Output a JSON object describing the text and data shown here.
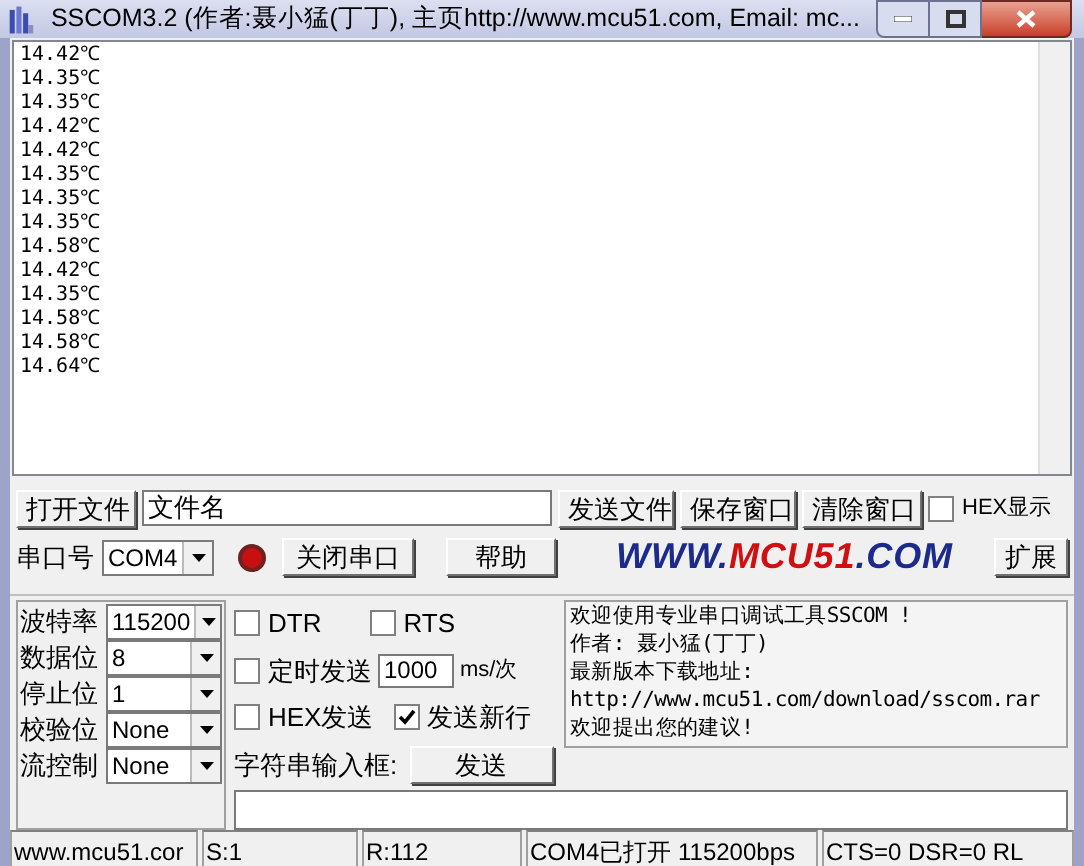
{
  "window": {
    "title": "SSCOM3.2 (作者:聂小猛(丁丁), 主页http://www.mcu51.com,  Email: mc..."
  },
  "receive_lines": [
    "14.42℃",
    "14.35℃",
    "14.35℃",
    "14.42℃",
    "14.42℃",
    "14.35℃",
    "14.35℃",
    "14.35℃",
    "14.58℃",
    "14.42℃",
    "14.35℃",
    "14.58℃",
    "14.58℃",
    "14.64℃"
  ],
  "file_row": {
    "open_file_button": "打开文件",
    "file_name_field": "文件名",
    "send_file_button": "发送文件",
    "save_window_button": "保存窗口",
    "clear_window_button": "清除窗口",
    "hex_display": {
      "label": "HEX显示",
      "checked": false
    }
  },
  "port_row": {
    "port_label": "串口号",
    "port_value": "COM4",
    "port_open": true,
    "close_port_button": "关闭串口",
    "help_button": "帮助",
    "logo_parts": [
      {
        "text": "WWW.",
        "color": "#1c2a8c"
      },
      {
        "text": "MCU51",
        "color": "#d01010"
      },
      {
        "text": ".COM",
        "color": "#1c2a8c"
      }
    ],
    "expand_button": "扩展"
  },
  "settings": [
    {
      "label": "波特率",
      "value": "115200"
    },
    {
      "label": "数据位",
      "value": "8"
    },
    {
      "label": "停止位",
      "value": "1"
    },
    {
      "label": "校验位",
      "value": "None"
    },
    {
      "label": "流控制",
      "value": "None"
    }
  ],
  "options": {
    "dtr": {
      "label": "DTR",
      "checked": false
    },
    "rts": {
      "label": "RTS",
      "checked": false
    },
    "timed_send": {
      "label": "定时发送",
      "checked": false
    },
    "interval": "1000",
    "interval_unit": "ms/次",
    "hex_send": {
      "label": "HEX发送",
      "checked": false
    },
    "send_newline": {
      "label": "发送新行",
      "checked": true
    },
    "input_label": "字符串输入框:",
    "send_button": "发送"
  },
  "info_lines": [
    "欢迎使用专业串口调试工具SSCOM !",
    "作者: 聂小猛(丁丁)",
    "最新版本下载地址:",
    "http://www.mcu51.com/download/sscom.rar",
    "欢迎提出您的建议!"
  ],
  "status_bar": [
    "www.mcu51.cor",
    "S:1",
    "R:112",
    "COM4已打开  115200bps",
    "CTS=0 DSR=0 RL"
  ]
}
